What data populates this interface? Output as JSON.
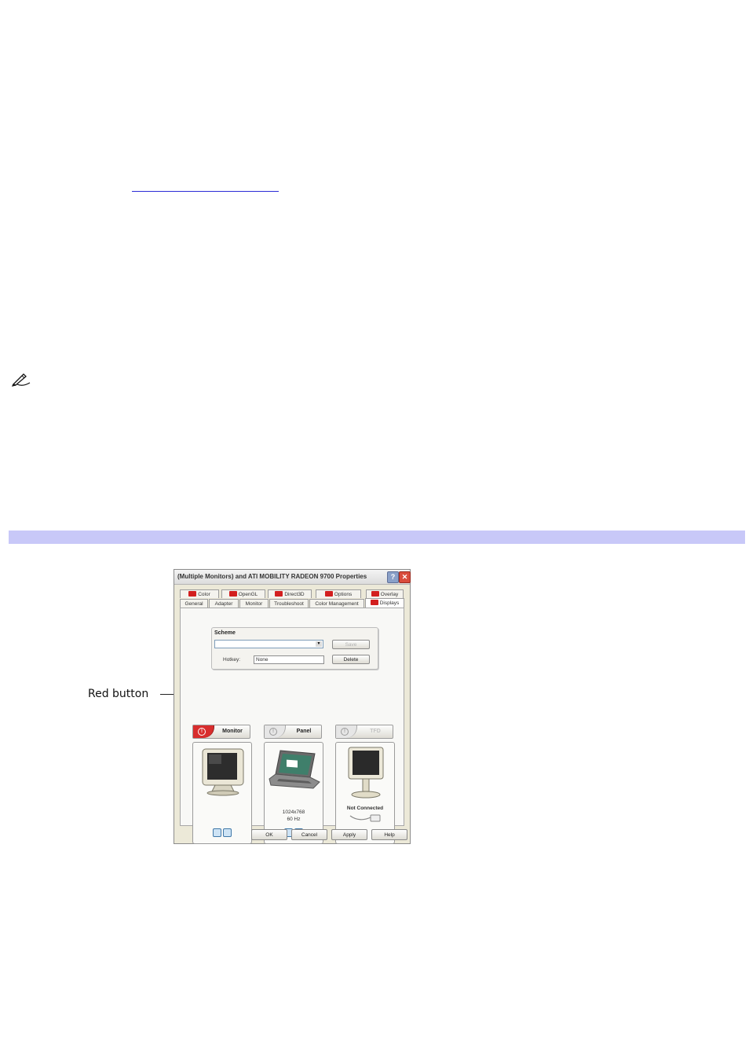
{
  "callout": {
    "label": "Red button"
  },
  "dialog": {
    "title": "(Multiple Monitors) and ATI MOBILITY RADEON 9700 Properties",
    "help_glyph": "?",
    "close_glyph": "✕",
    "tabs_row1": [
      "Color",
      "OpenGL",
      "Direct3D",
      "Options",
      "Overlay"
    ],
    "tabs_row2": [
      "General",
      "Adapter",
      "Monitor",
      "Troubleshoot",
      "Color Management",
      "Displays"
    ],
    "scheme": {
      "title": "Scheme",
      "selected": "",
      "hotkey_label": "Hotkey:",
      "hotkey_value": "None",
      "save_label": "Save",
      "delete_label": "Delete"
    },
    "displays": [
      {
        "label": "Monitor",
        "state": "enabled"
      },
      {
        "label": "Panel",
        "state": "available",
        "resolution": "1024x768",
        "refresh": "60 Hz"
      },
      {
        "label": "TFD",
        "state": "disabled",
        "status": "Not Connected"
      }
    ],
    "buttons": {
      "ok": "OK",
      "cancel": "Cancel",
      "apply": "Apply",
      "help": "Help"
    }
  },
  "colors": {
    "band": "#c8c8f8",
    "red_button": "#d82d2d",
    "link_underline": "#2b2bd6"
  }
}
